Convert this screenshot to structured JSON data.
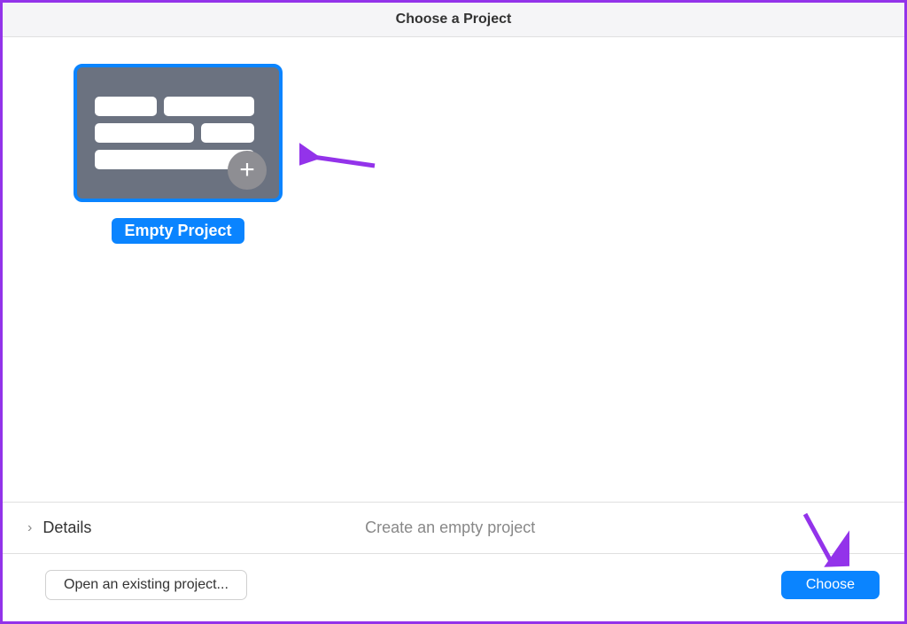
{
  "header": {
    "title": "Choose a Project"
  },
  "templates": {
    "empty_project": {
      "label": "Empty Project"
    }
  },
  "details": {
    "label": "Details",
    "description": "Create an empty project"
  },
  "footer": {
    "open_existing_label": "Open an existing project...",
    "choose_label": "Choose"
  }
}
